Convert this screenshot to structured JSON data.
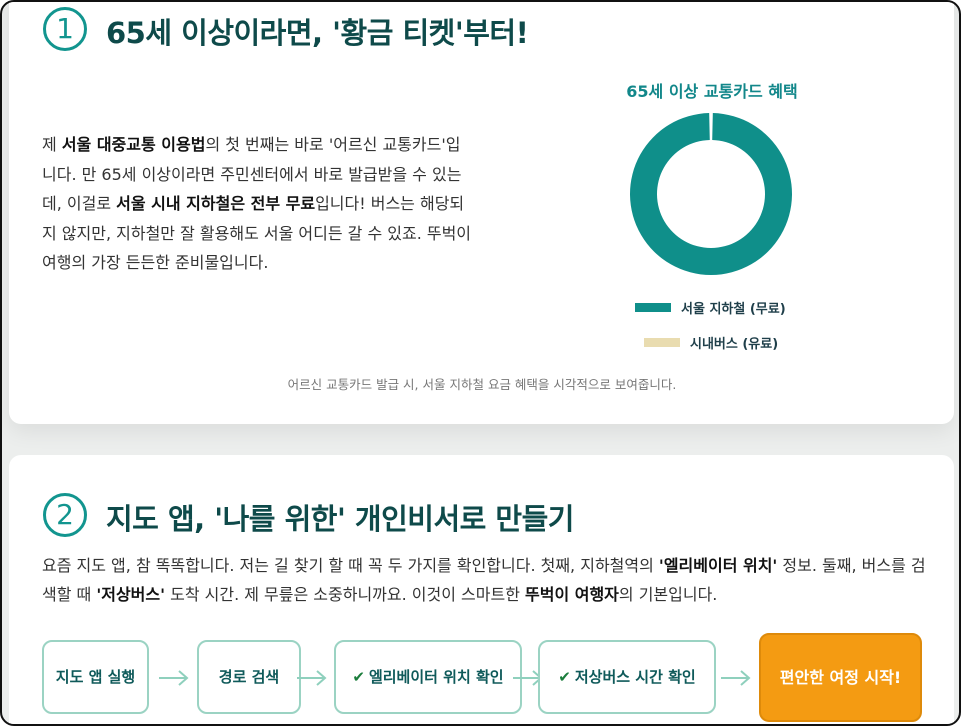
{
  "colors": {
    "accent": "#12958f",
    "title": "#0e4a4a",
    "subway": "#0f8f8a",
    "bus": "#e9dcb0",
    "final_step": "#f49b12"
  },
  "section1": {
    "number": "1",
    "title": "65세 이상이라면, '황금 티켓'부터!",
    "paragraph": {
      "t1": "제 ",
      "b1": "서울 대중교통 이용법",
      "t2": "의 첫 번째는 바로 '어르신 교통카드'입니다. 만 65세 이상이라면 주민센터에서 바로 발급받을 수 있는데, 이걸로 ",
      "b2": "서울 시내 지하철은 전부 무료",
      "t3": "입니다! 버스는 해당되지 않지만, 지하철만 잘 활용해도 서울 어디든 갈 수 있죠. 뚜벅이 여행의 가장 든든한 준비물입니다."
    },
    "chart_title": "65세 이상 교통카드 혜택",
    "caption": "어르신 교통카드 발급 시, 서울 지하철 요금 혜택을 시각적으로 보여줍니다."
  },
  "chart_data": {
    "type": "pie",
    "title": "65세 이상 교통카드 혜택",
    "categories": [
      "서울 지하철 (무료)",
      "시내버스 (유료)"
    ],
    "values": [
      100,
      0
    ],
    "colors": [
      "#0f8f8a",
      "#e9dcb0"
    ],
    "legend": "bottom"
  },
  "section2": {
    "number": "2",
    "title": "지도 앱, '나를 위한' 개인비서로 만들기",
    "paragraph": {
      "t1": "요즘 지도 앱, 참 똑똑합니다. 저는 길 찾기 할 때 꼭 두 가지를 확인합니다. 첫째, 지하철역의 ",
      "b1": "'엘리베이터 위치'",
      "t2": " 정보. 둘째, 버스를 검색할 때 ",
      "b2": "'저상버스'",
      "t3": " 도착 시간. 제 무릎은 소중하니까요. 이것이 스마트한 ",
      "b3": "뚜벅이 여행자",
      "t4": "의 기본입니다."
    },
    "steps": [
      {
        "label": "지도 앱 실행"
      },
      {
        "label": "경로 검색"
      },
      {
        "label": "엘리베이터 위치 확인",
        "check": "✔"
      },
      {
        "label": "저상버스 시간 확인",
        "check": "✔"
      }
    ],
    "final_step": "편안한 여정 시작!"
  }
}
